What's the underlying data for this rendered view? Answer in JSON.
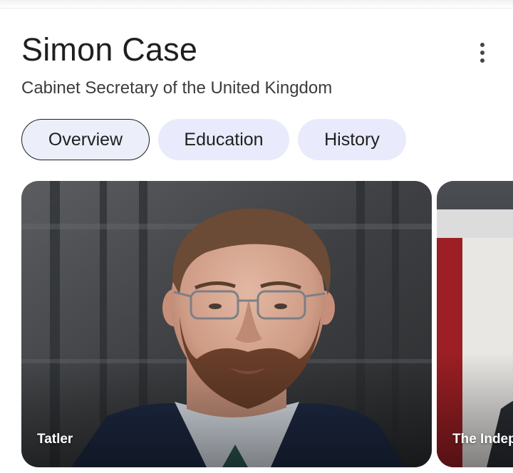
{
  "entity": {
    "name": "Simon Case",
    "description": "Cabinet Secretary of the United Kingdom"
  },
  "tabs": [
    {
      "label": "Overview",
      "selected": true
    },
    {
      "label": "Education",
      "selected": false
    },
    {
      "label": "History",
      "selected": false
    }
  ],
  "images": [
    {
      "source": "Tatler"
    },
    {
      "source": "The Indep"
    }
  ],
  "icons": {
    "more": "more-vert-icon"
  },
  "colors": {
    "chip_bg": "#e9eafb",
    "chip_selected_border": "#1f1f1f",
    "text_primary": "#1f1f1f"
  }
}
